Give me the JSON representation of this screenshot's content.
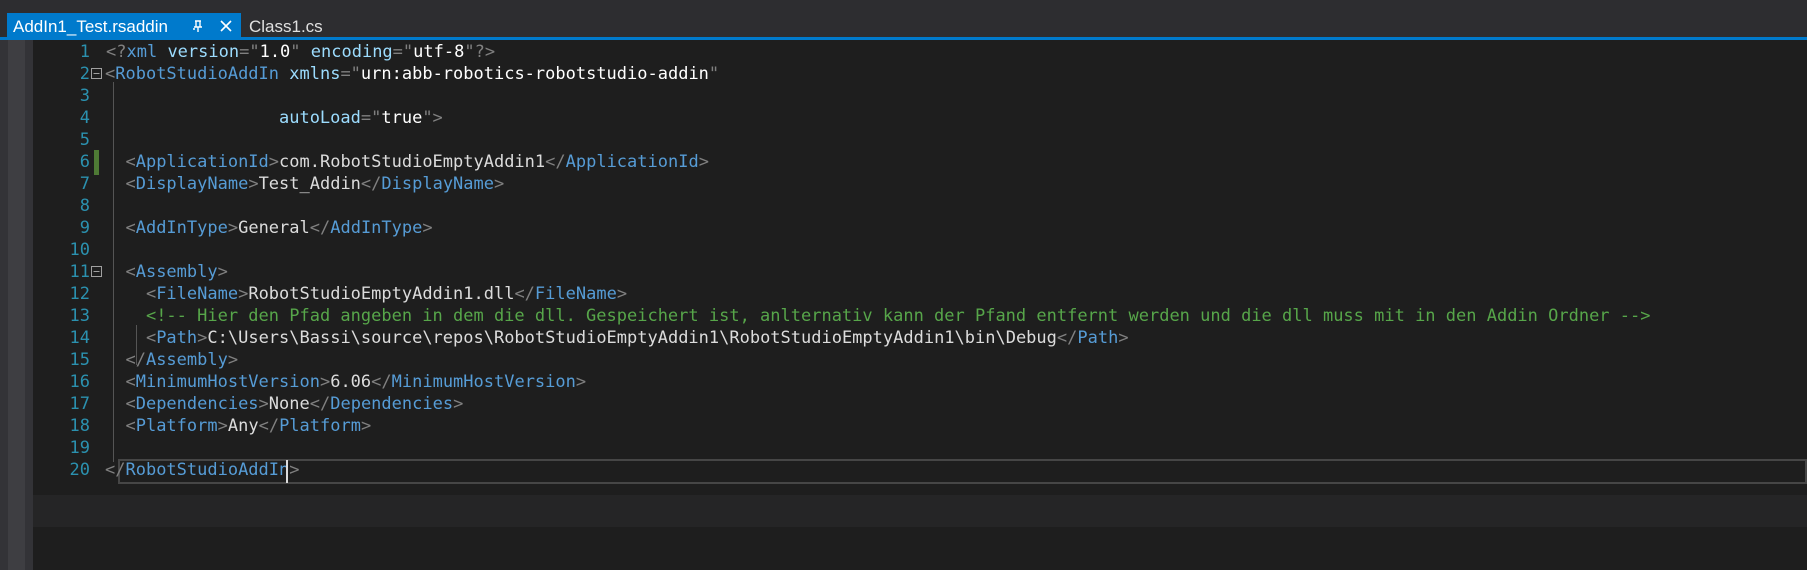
{
  "tabs": [
    {
      "label": "AddIn1_Test.rsaddin",
      "active": true
    },
    {
      "label": "Class1.cs",
      "active": false
    }
  ],
  "icons": {
    "pin": "pin-icon",
    "close": "close-icon",
    "fold": "collapse-minus-icon"
  },
  "colors": {
    "accent": "#007acc",
    "tag": "#569cd6",
    "attribute": "#9cdcfe",
    "comment": "#57a64a",
    "line_number": "#2b91af",
    "background": "#1e1e1e"
  },
  "editor": {
    "line_numbers": [
      "1",
      "2",
      "3",
      "4",
      "5",
      "6",
      "7",
      "8",
      "9",
      "10",
      "11",
      "12",
      "13",
      "14",
      "15",
      "16",
      "17",
      "18",
      "19",
      "20"
    ],
    "lines": {
      "l1": {
        "a": "<?",
        "b": "xml",
        "c": " version",
        "d": "=\"",
        "e": "1.0",
        "f": "\"",
        "g": " encoding",
        "h": "=\"",
        "i": "utf-8",
        "j": "\"?>"
      },
      "l2": {
        "a": "<",
        "b": "RobotStudioAddIn",
        "c": " xmlns",
        "d": "=\"",
        "e": "urn:abb-robotics-robotstudio-addin",
        "f": "\""
      },
      "l4": {
        "a": "                 autoLoad",
        "b": "=\"",
        "c": "true",
        "d": "\">"
      },
      "l6": {
        "a": "  <",
        "b": "ApplicationId",
        "c": ">",
        "d": "com.RobotStudioEmptyAddin1",
        "e": "</",
        "f": "ApplicationId",
        "g": ">"
      },
      "l7": {
        "a": "  <",
        "b": "DisplayName",
        "c": ">",
        "d": "Test_Addin",
        "e": "</",
        "f": "DisplayName",
        "g": ">"
      },
      "l9": {
        "a": "  <",
        "b": "AddInType",
        "c": ">",
        "d": "General",
        "e": "</",
        "f": "AddInType",
        "g": ">"
      },
      "l11": {
        "a": "  <",
        "b": "Assembly",
        "c": ">"
      },
      "l12": {
        "a": "    <",
        "b": "FileName",
        "c": ">",
        "d": "RobotStudioEmptyAddin1.dll",
        "e": "</",
        "f": "FileName",
        "g": ">"
      },
      "l13": {
        "a": "    ",
        "b": "<!-- Hier den Pfad angeben in dem die dll. Gespeichert ist, anlternativ kann der Pfand entfernt werden und die dll muss mit in den Addin Ordner -->"
      },
      "l14": {
        "a": "    <",
        "b": "Path",
        "c": ">",
        "d": "C:\\Users\\Bassi\\source\\repos\\RobotStudioEmptyAddin1\\RobotStudioEmptyAddin1\\bin\\Debug",
        "e": "</",
        "f": "Path",
        "g": ">"
      },
      "l15": {
        "a": "  </",
        "b": "Assembly",
        "c": ">"
      },
      "l16": {
        "a": "  <",
        "b": "MinimumHostVersion",
        "c": ">",
        "d": "6.06",
        "e": "</",
        "f": "MinimumHostVersion",
        "g": ">"
      },
      "l17": {
        "a": "  <",
        "b": "Dependencies",
        "c": ">",
        "d": "None",
        "e": "</",
        "f": "Dependencies",
        "g": ">"
      },
      "l18": {
        "a": "  <",
        "b": "Platform",
        "c": ">",
        "d": "Any",
        "e": "</",
        "f": "Platform",
        "g": ">"
      },
      "l20": {
        "a": "</",
        "b": "RobotStudioAddIn",
        "c": ">"
      }
    }
  }
}
